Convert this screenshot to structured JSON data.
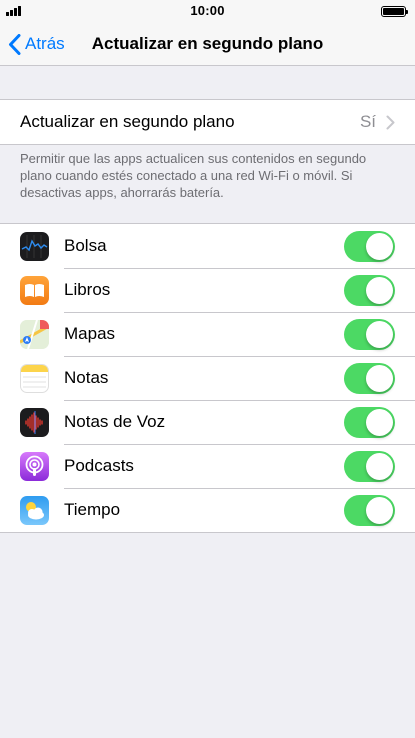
{
  "status_bar": {
    "time": "10:00"
  },
  "nav": {
    "back_label": "Atrás",
    "title": "Actualizar en segundo plano"
  },
  "main_setting": {
    "label": "Actualizar en segundo plano",
    "value": "Sí"
  },
  "footer": "Permitir que las apps actualicen sus contenidos en segundo plano cuando estés conectado a una red Wi-Fi o móvil. Si desactivas apps, ahorrarás batería.",
  "apps": [
    {
      "label": "Bolsa",
      "icon": "stocks-icon",
      "enabled": true
    },
    {
      "label": "Libros",
      "icon": "books-icon",
      "enabled": true
    },
    {
      "label": "Mapas",
      "icon": "maps-icon",
      "enabled": true
    },
    {
      "label": "Notas",
      "icon": "notes-icon",
      "enabled": true
    },
    {
      "label": "Notas de Voz",
      "icon": "voice-memos-icon",
      "enabled": true
    },
    {
      "label": "Podcasts",
      "icon": "podcasts-icon",
      "enabled": true
    },
    {
      "label": "Tiempo",
      "icon": "weather-icon",
      "enabled": true
    }
  ],
  "colors": {
    "accent": "#007aff",
    "switch_on": "#4cd964",
    "background": "#efeff4"
  }
}
